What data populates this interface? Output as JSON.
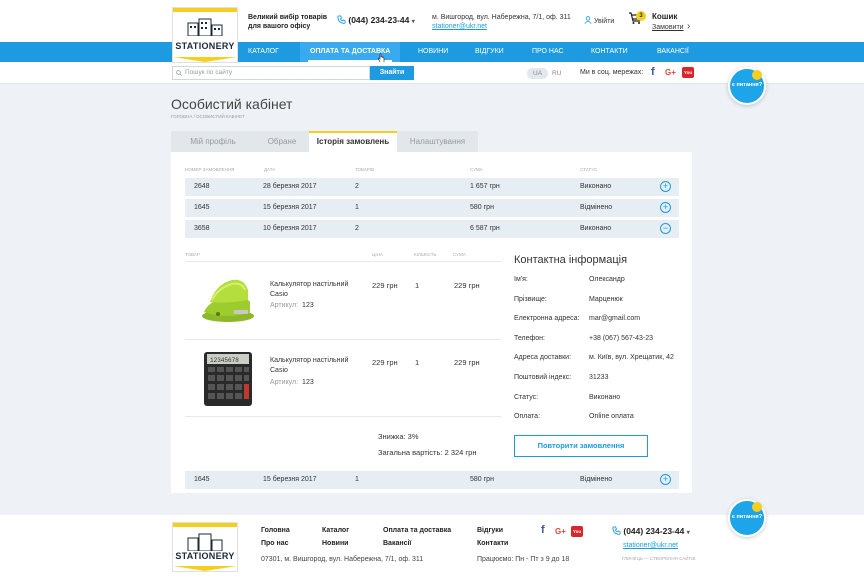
{
  "header": {
    "logo_text": "STATIONERY",
    "promo_line1": "Великий вибір товарів",
    "promo_line2": "для вашого офісу",
    "phone": "(044) 234-23-44",
    "address": "м. Вишгород, вул. Набережна, 7/1, оф. 311",
    "email": "stationer@ukr.net",
    "login_label": "Увійти",
    "cart_count": "3",
    "cart_title": "Кошик",
    "cart_link": "Замовити"
  },
  "nav": {
    "items": [
      "Каталог",
      "Оплата та доставка",
      "Новини",
      "Відгуки",
      "Про нас",
      "Контакти",
      "Вакансії"
    ],
    "active_index": 1
  },
  "search": {
    "placeholder": "Пошук по сайту",
    "button_label": "Знайти"
  },
  "lang": {
    "ua": "UA",
    "ru": "RU"
  },
  "social": {
    "label": "Ми в соц. мережах:",
    "fb": "f",
    "gplus": "G+",
    "yt": "You"
  },
  "callback_label": "є питання?",
  "page": {
    "title": "Особистий кабінет",
    "breadcrumbs": "Головна / Особистий кабінет"
  },
  "tabs": [
    "Мій профіль",
    "Обране",
    "Історія замовлень",
    "Налаштування"
  ],
  "orders_table": {
    "headers": [
      "Номер замовлення",
      "Дата",
      "Товарів",
      "Сума",
      "Статус"
    ],
    "rows": [
      {
        "num": "2648",
        "date": "28 березня 2017",
        "qty": "2",
        "sum": "1 657 грн",
        "status": "Виконано",
        "toggle": "+"
      },
      {
        "num": "1645",
        "date": "15 березня 2017",
        "qty": "1",
        "sum": "580 грн",
        "status": "Відмінено",
        "toggle": "+"
      },
      {
        "num": "3658",
        "date": "10 березня 2017",
        "qty": "2",
        "sum": "6 587 грн",
        "status": "Виконано",
        "toggle": "−"
      }
    ],
    "last_row": {
      "num": "1645",
      "date": "15 березня 2017",
      "qty": "1",
      "sum": "580 грн",
      "status": "Відмінено",
      "toggle": "+"
    }
  },
  "order_items": {
    "headers": [
      "Товар",
      "Ціна",
      "Кількість",
      "Сума"
    ],
    "items": [
      {
        "name_line1": "Калькулятор настільний",
        "name_line2": "Casio",
        "sku_label": "Артикул:",
        "sku": "123",
        "price": "229 грн",
        "qty": "1",
        "sum": "229 грн"
      },
      {
        "name_line1": "Калькулятор настільний",
        "name_line2": "Casio",
        "sku_label": "Артикул:",
        "sku": "123",
        "price": "229 грн",
        "qty": "1",
        "sum": "229 грн"
      }
    ],
    "discount": "Знижка: 3%",
    "total": "Загальна вартість: 2 324 грн"
  },
  "contact": {
    "title": "Контактна інформація",
    "fields": [
      {
        "label": "Ім'я:",
        "value": "Олександр"
      },
      {
        "label": "Прізвище:",
        "value": "Марценюк"
      },
      {
        "label": "Електронна адреса:",
        "value": "mar@gmail.com"
      },
      {
        "label": "Телефон:",
        "value": "+38 (067) 567-43-23"
      },
      {
        "label": "Адреса доставки:",
        "value": "м. Київ, вул. Хрещатик, 42"
      },
      {
        "label": "Поштовий індекс:",
        "value": "31233"
      },
      {
        "label": "Статус:",
        "value": "Виконано"
      },
      {
        "label": "Оплата:",
        "value": "Online оплата"
      }
    ],
    "repeat_button": "Повторити замовлення"
  },
  "footer": {
    "links": [
      "Головна",
      "Каталог",
      "Оплата та доставка",
      "Відгуки",
      "Про нас",
      "Новини",
      "Вакансії",
      "Контакти"
    ],
    "address": "07301, м. Вишгород, вул. Набережна, 7/1, оф. 311",
    "hours": "Працюємо: Пн - Пт з 9 до 18",
    "phone": "(044) 234-23-44",
    "email": "stationer@ukr.net",
    "developer": "ГЛИНЕЦЬ — СТВОРЕННЯ САЙТІВ"
  },
  "colors": {
    "accent": "#1e9be0",
    "brand_yellow": "#f4cf1e",
    "youtube": "#d8262b",
    "gplus": "#dd4b39",
    "facebook": "#3b5998"
  }
}
